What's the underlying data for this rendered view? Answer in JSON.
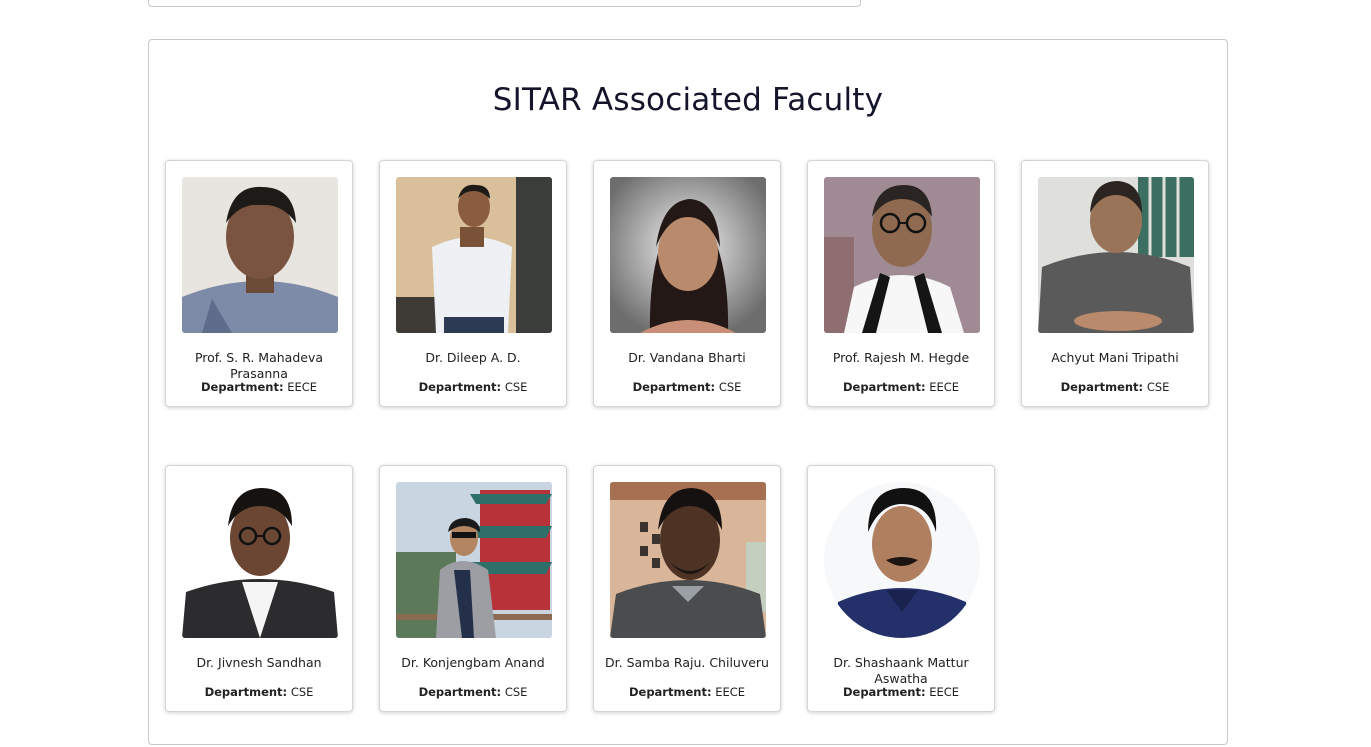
{
  "section": {
    "title": "SITAR Associated Faculty"
  },
  "dept_label": "Department:",
  "faculty": [
    {
      "name": "Prof. S. R. Mahadeva Prasanna",
      "department": "EECE",
      "photo": "portrait-photo"
    },
    {
      "name": "Dr. Dileep A. D.",
      "department": "CSE",
      "photo": "portrait-photo"
    },
    {
      "name": "Dr. Vandana Bharti",
      "department": "CSE",
      "photo": "portrait-photo"
    },
    {
      "name": "Prof. Rajesh M. Hegde",
      "department": "EECE",
      "photo": "portrait-photo"
    },
    {
      "name": "Achyut Mani Tripathi",
      "department": "CSE",
      "photo": "portrait-photo"
    },
    {
      "name": "Dr. Jivnesh Sandhan",
      "department": "CSE",
      "photo": "portrait-photo"
    },
    {
      "name": "Dr. Konjengbam Anand",
      "department": "CSE",
      "photo": "portrait-photo"
    },
    {
      "name": "Dr. Samba Raju. Chiluveru",
      "department": "EECE",
      "photo": "portrait-photo"
    },
    {
      "name": "Dr. Shashaank Mattur Aswatha",
      "department": "EECE",
      "photo": "portrait-photo"
    }
  ]
}
